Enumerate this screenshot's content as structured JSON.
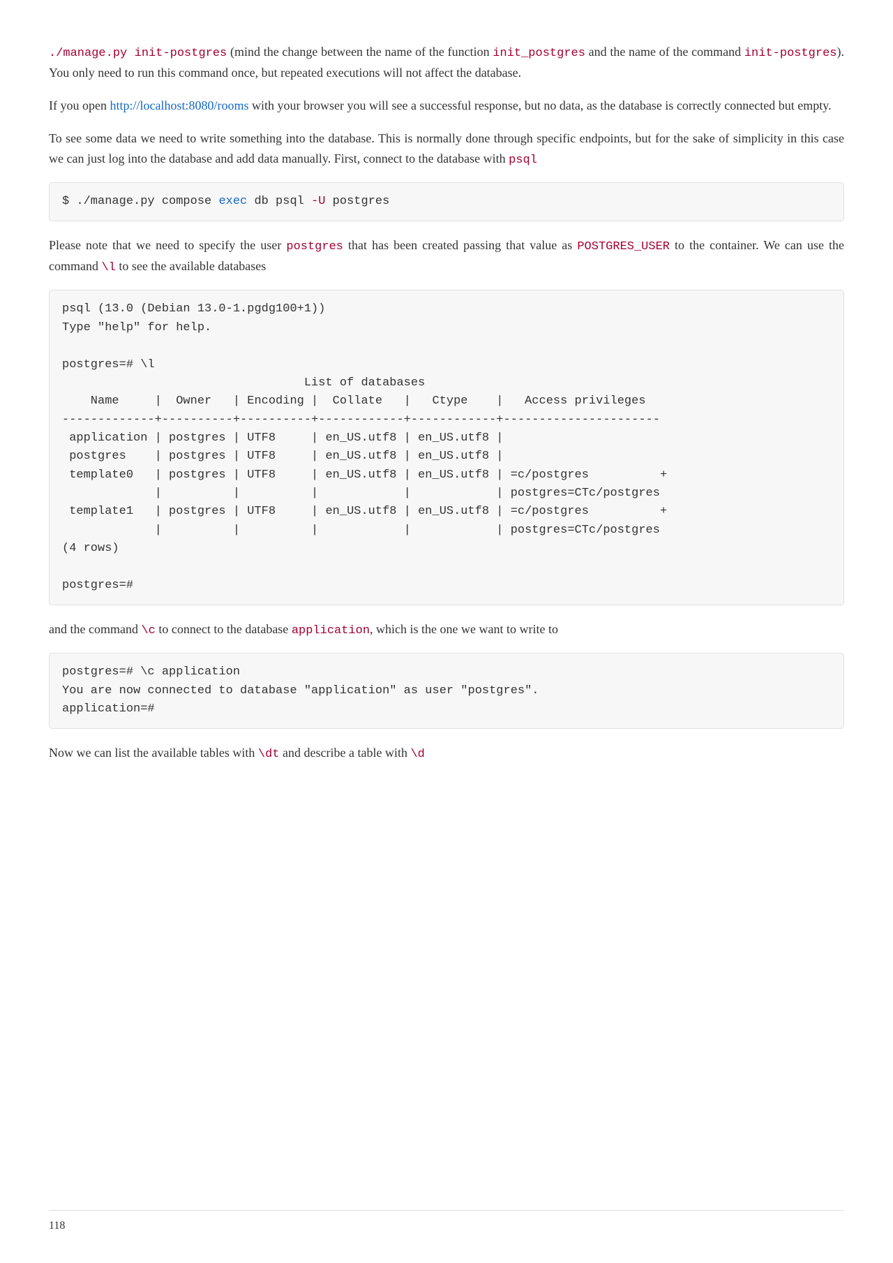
{
  "para1": {
    "code1": "./manage.py init-postgres",
    "text1": " (mind the change between the name of the function ",
    "code2": "init_postgres",
    "text2": " and the name of the command ",
    "code3": "init-postgres",
    "text3": "). You only need to run this command once, but repeated executions will not affect the database."
  },
  "para2": {
    "text1": "If you open ",
    "link": "http://localhost:8080/rooms",
    "text2": " with your browser you will see a successful response, but no data, as the database is correctly connected but empty."
  },
  "para3": {
    "text1": "To see some data we need to write something into the database. This is normally done through specific endpoints, but for the sake of simplicity in this case we can just log into the database and add data manually. First, connect to the database with ",
    "code1": "psql"
  },
  "codeblock1": {
    "prefix": "$ ./manage.py compose ",
    "kw": "exec",
    "mid": " db psql ",
    "flag": "-U",
    "suffix": " postgres"
  },
  "para4": {
    "text1": "Please note that we need to specify the user ",
    "code1": "postgres",
    "text2": " that has been created passing that value as ",
    "code2": "POSTGRES_USER",
    "text3": " to the container. We can use the command ",
    "code3": "\\l",
    "text4": " to see the available databases"
  },
  "codeblock2": "psql (13.0 (Debian 13.0-1.pgdg100+1))\nType \"help\" for help.\n\npostgres=# \\l\n                                  List of databases\n    Name     |  Owner   | Encoding |  Collate   |   Ctype    |   Access privileges\n-------------+----------+----------+------------+------------+----------------------\n application | postgres | UTF8     | en_US.utf8 | en_US.utf8 |\n postgres    | postgres | UTF8     | en_US.utf8 | en_US.utf8 |\n template0   | postgres | UTF8     | en_US.utf8 | en_US.utf8 | =c/postgres          +\n             |          |          |            |            | postgres=CTc/postgres\n template1   | postgres | UTF8     | en_US.utf8 | en_US.utf8 | =c/postgres          +\n             |          |          |            |            | postgres=CTc/postgres\n(4 rows)\n\npostgres=#",
  "para5": {
    "text1": "and the command ",
    "code1": "\\c",
    "text2": " to connect to the database ",
    "code2": "application",
    "text3": ", which is the one we want to write to"
  },
  "codeblock3": "postgres=# \\c application\nYou are now connected to database \"application\" as user \"postgres\".\napplication=#",
  "para6": {
    "text1": "Now we can list the available tables with ",
    "code1": "\\dt",
    "text2": " and describe a table with ",
    "code2": "\\d"
  },
  "pageNumber": "118"
}
